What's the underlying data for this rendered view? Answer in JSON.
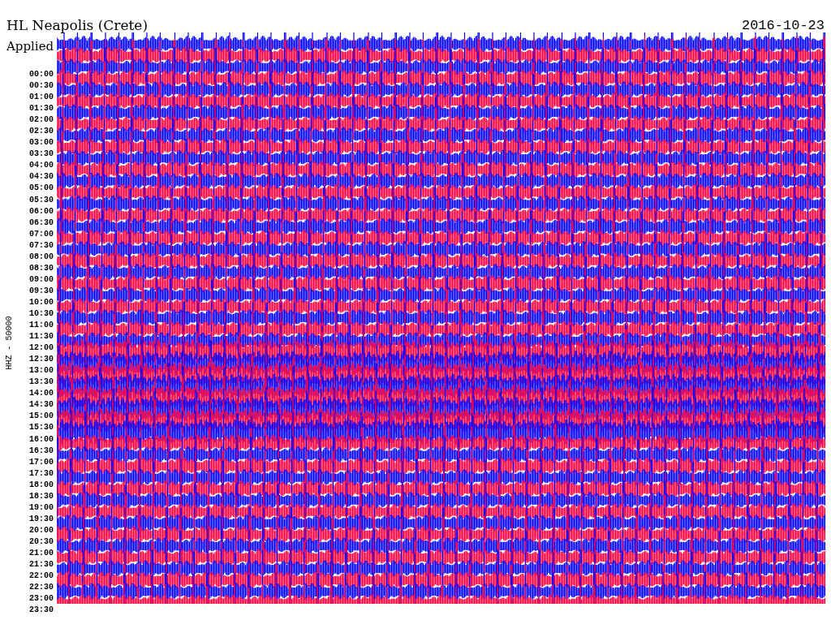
{
  "title": "HL Neapolis (Crete)",
  "date": "2016-10-23",
  "filter_label": "Applied",
  "axis_label": "HHZ - 50000",
  "time_labels": [
    "00:00",
    "00:30",
    "01:00",
    "01:30",
    "02:00",
    "02:30",
    "03:00",
    "03:30",
    "04:00",
    "04:30",
    "05:00",
    "05:30",
    "06:00",
    "06:30",
    "07:00",
    "07:30",
    "08:00",
    "08:30",
    "09:00",
    "09:30",
    "10:00",
    "10:30",
    "11:00",
    "11:30",
    "12:00",
    "12:30",
    "13:00",
    "13:30",
    "14:00",
    "14:30",
    "15:00",
    "15:30",
    "16:00",
    "16:30",
    "17:00",
    "17:30",
    "18:00",
    "18:30",
    "19:00",
    "19:30",
    "20:00",
    "20:30",
    "21:00",
    "21:30",
    "22:00",
    "22:30",
    "23:00",
    "23:30"
  ]
}
